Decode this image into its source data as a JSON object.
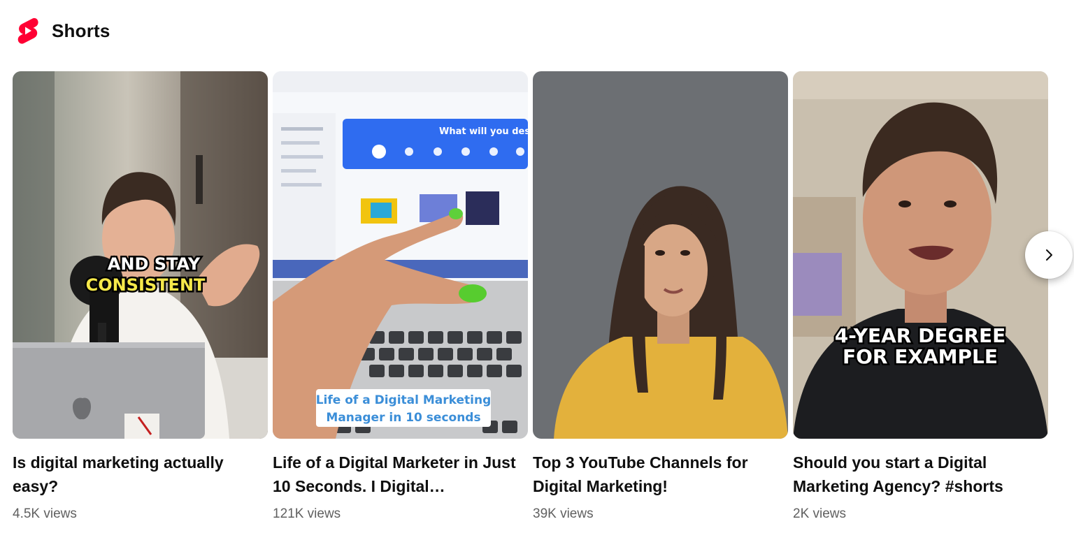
{
  "section": {
    "title": "Shorts",
    "logo_icon": "youtube-shorts-icon",
    "logo_color": "#ff0033"
  },
  "cards": [
    {
      "title": "Is digital marketing actually easy?",
      "views": "4.5K views",
      "overlay_line1": "AND STAY",
      "overlay_line2": "CONSISTENT"
    },
    {
      "title": "Life of a Digital Marketer in Just 10 Seconds. I Digital…",
      "views": "121K views",
      "screen_banner": "What will you design?",
      "caption_line1": "Life of a Digital Marketing",
      "caption_line2": "Manager in  10 seconds"
    },
    {
      "title": "Top 3 YouTube Channels for Digital Marketing!",
      "views": "39K views"
    },
    {
      "title": "Should you start a Digital Marketing Agency? #shorts",
      "views": "2K views",
      "overlay_line1": "4-YEAR DEGREE",
      "overlay_line2": "FOR EXAMPLE"
    }
  ],
  "navigation": {
    "next_icon": "chevron-right-icon"
  }
}
